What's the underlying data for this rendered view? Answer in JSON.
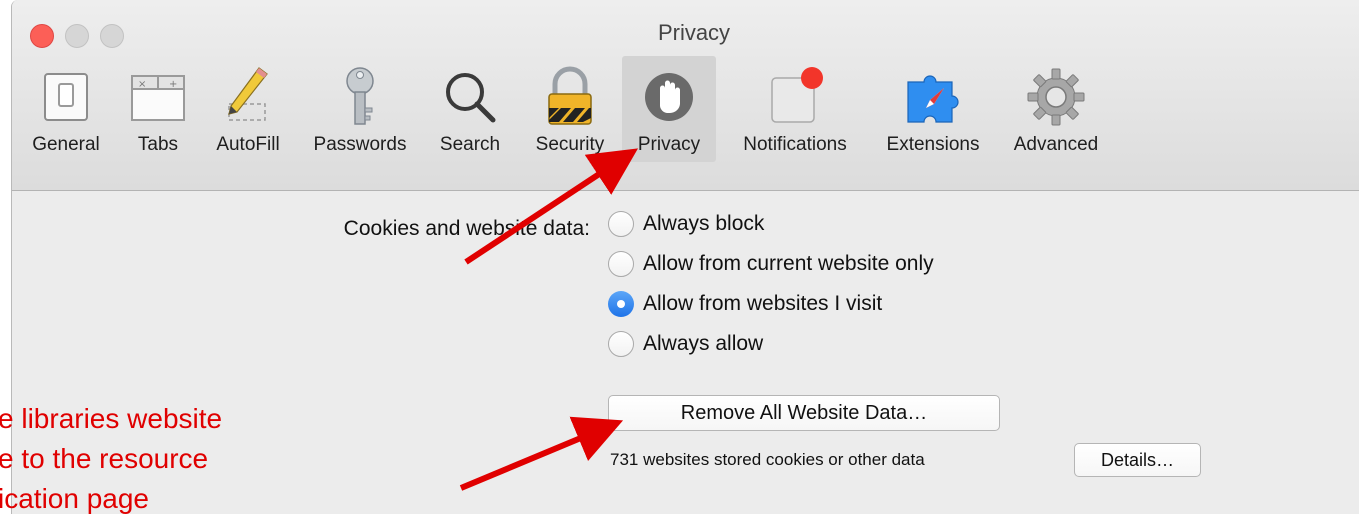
{
  "window": {
    "title": "Privacy"
  },
  "toolbar": {
    "items": [
      {
        "label": "General",
        "icon": "general-switch-icon"
      },
      {
        "label": "Tabs",
        "icon": "tabs-icon"
      },
      {
        "label": "AutoFill",
        "icon": "pencil-icon"
      },
      {
        "label": "Passwords",
        "icon": "key-icon"
      },
      {
        "label": "Search",
        "icon": "magnifier-icon"
      },
      {
        "label": "Security",
        "icon": "padlock-icon"
      },
      {
        "label": "Privacy",
        "icon": "hand-icon",
        "selected": true
      },
      {
        "label": "Notifications",
        "icon": "notifications-badge-icon"
      },
      {
        "label": "Extensions",
        "icon": "puzzle-compass-icon"
      },
      {
        "label": "Advanced",
        "icon": "gear-icon"
      }
    ]
  },
  "privacy": {
    "cookies_label": "Cookies and website data:",
    "options": [
      {
        "label": "Always block",
        "checked": false
      },
      {
        "label": "Allow from current website only",
        "checked": false
      },
      {
        "label": "Allow from websites I visit",
        "checked": true
      },
      {
        "label": "Always allow",
        "checked": false
      }
    ],
    "remove_button": "Remove All Website Data…",
    "stored_text": "731 websites stored cookies or other data",
    "details_button": "Details…"
  },
  "annotation": {
    "lines": [
      "e libraries website",
      "e to the resource",
      "ication page"
    ],
    "color": "#e00000"
  },
  "colors": {
    "close": "#fc5f57",
    "accent": "#1f73e8",
    "arrow": "#e00000"
  }
}
